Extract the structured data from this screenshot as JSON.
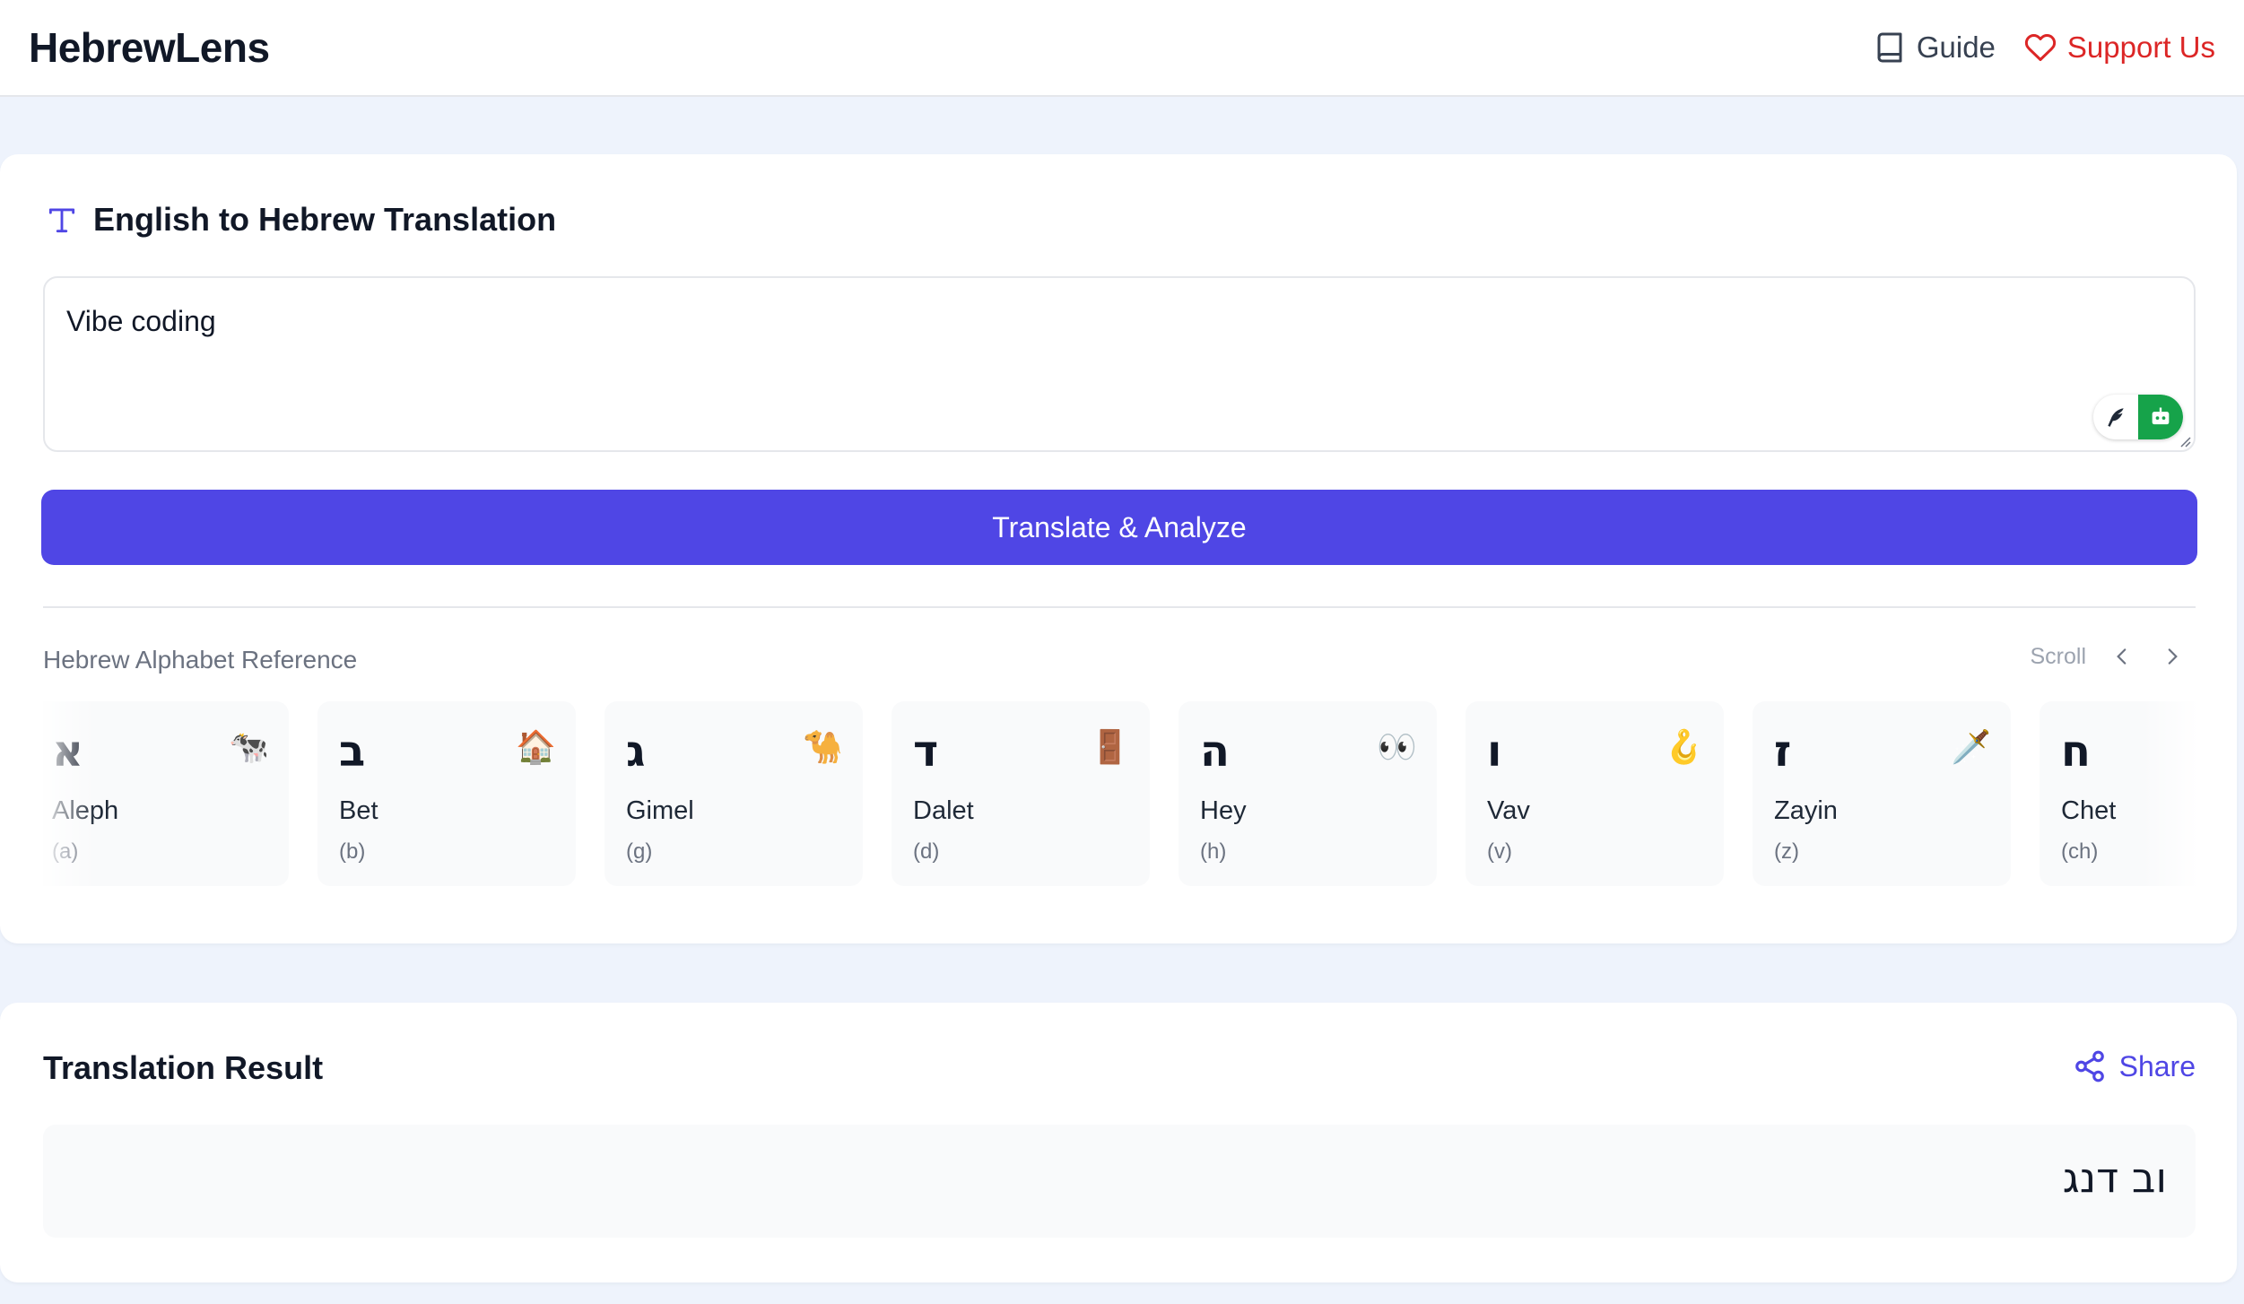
{
  "header": {
    "logo": "HebrewLens",
    "guide_label": "Guide",
    "support_label": "Support Us"
  },
  "translator": {
    "title": "English to Hebrew Translation",
    "input_value": "Vibe coding",
    "button_label": "Translate & Analyze"
  },
  "alphabet": {
    "label": "Hebrew Alphabet Reference",
    "scroll_label": "Scroll",
    "letters": [
      {
        "glyph": "א",
        "name": "Aleph",
        "sound": "(a)",
        "emoji": "🐄"
      },
      {
        "glyph": "ב",
        "name": "Bet",
        "sound": "(b)",
        "emoji": "🏠"
      },
      {
        "glyph": "ג",
        "name": "Gimel",
        "sound": "(g)",
        "emoji": "🐪"
      },
      {
        "glyph": "ד",
        "name": "Dalet",
        "sound": "(d)",
        "emoji": "🚪"
      },
      {
        "glyph": "ה",
        "name": "Hey",
        "sound": "(h)",
        "emoji": "👀"
      },
      {
        "glyph": "ו",
        "name": "Vav",
        "sound": "(v)",
        "emoji": "🪝"
      },
      {
        "glyph": "ז",
        "name": "Zayin",
        "sound": "(z)",
        "emoji": "🗡️"
      },
      {
        "glyph": "ח",
        "name": "Chet",
        "sound": "(ch)",
        "emoji": ""
      }
    ]
  },
  "result": {
    "title": "Translation Result",
    "share_label": "Share",
    "hebrew_text": "וב דנג"
  },
  "colors": {
    "accent": "#4f46e5",
    "support": "#dc2626",
    "bot": "#16a34a"
  }
}
